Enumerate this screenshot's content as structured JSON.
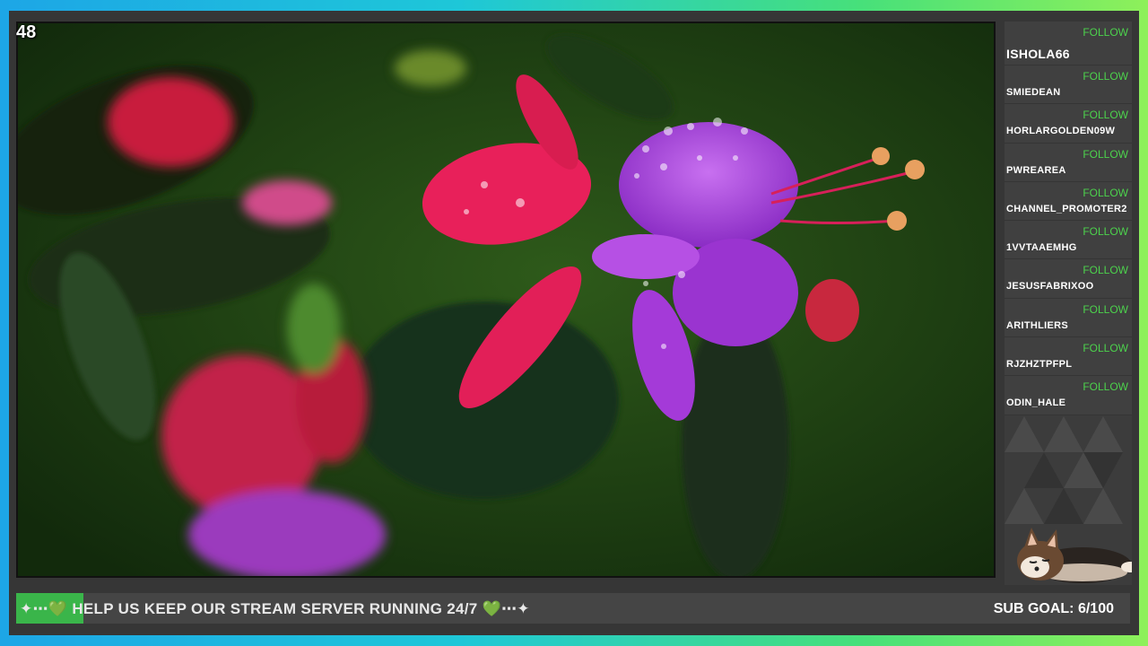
{
  "stream": {
    "viewer_count": "48",
    "video_description_colors": {
      "background": "#1f3d14",
      "flower_pink": "#e8205a",
      "flower_purple": "#a43ad8"
    }
  },
  "sidebar": {
    "follow_label": "FOLLOW",
    "followers": [
      {
        "name": "ISHOLA66"
      },
      {
        "name": "SMIEDEAN"
      },
      {
        "name": "HORLARGOLDEN09W"
      },
      {
        "name": "PWREAREA"
      },
      {
        "name": "CHANNEL_PROMOTER2"
      },
      {
        "name": "1VVTAAEMHG"
      },
      {
        "name": "JESUSFABRIXOO"
      },
      {
        "name": "ARITHLIERS"
      },
      {
        "name": "RJZHZTPFPL"
      },
      {
        "name": "ODIN_HALE"
      }
    ],
    "mascot_icon": "sleeping-corgi-icon"
  },
  "ticker": {
    "message": "✦⋯💚 HELP US KEEP OUR STREAM SERVER RUNNING 24/7 💚⋯✦",
    "sub_goal": "SUB GOAL: 6/100",
    "accent_color": "#3ab54a"
  }
}
